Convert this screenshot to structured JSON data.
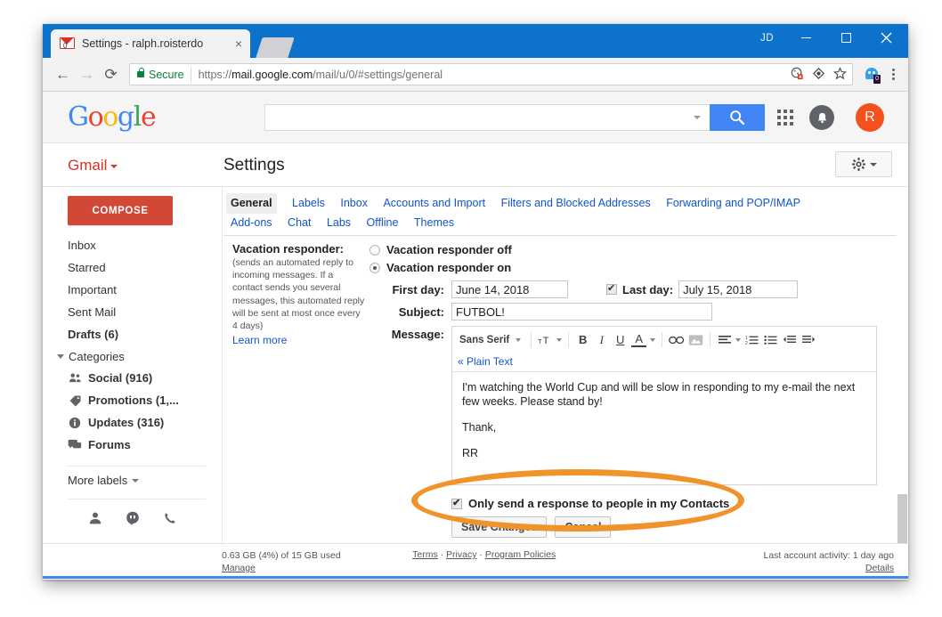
{
  "window": {
    "profile_label": "JD",
    "minimize_label": "Minimize",
    "maximize_label": "Maximize",
    "close_label": "Close"
  },
  "tab": {
    "title": "Settings - ralph.roisterdo",
    "badge_count": "0",
    "close_label": "×",
    "favicon": "gmail-icon"
  },
  "browser": {
    "back_icon": "←",
    "forward_icon": "→",
    "reload_icon": "⟳",
    "security_label": "Secure",
    "url_scheme": "https://",
    "url_host": "mail.google.com",
    "url_path": "/mail/u/0/#settings/general",
    "url_full": "https://mail.google.com/mail/u/0/#settings/general",
    "extension_badge": "0",
    "menu_icon": "kebab-menu-icon"
  },
  "gheader": {
    "logo": "Google",
    "logo_letters": [
      {
        "ch": "G",
        "cls": "b"
      },
      {
        "ch": "o",
        "cls": "r"
      },
      {
        "ch": "o",
        "cls": "y"
      },
      {
        "ch": "g",
        "cls": "b"
      },
      {
        "ch": "l",
        "cls": "g"
      },
      {
        "ch": "e",
        "cls": "r"
      }
    ],
    "search_value": "",
    "search_placeholder": "",
    "search_button_icon": "search-icon",
    "apps_icon": "apps-grid-icon",
    "notifications_icon": "bell-icon",
    "avatar_letter": "R"
  },
  "subheader": {
    "gmail_label": "Gmail",
    "page_title": "Settings",
    "gear_icon": "gear-icon"
  },
  "sidebar": {
    "compose_label": "COMPOSE",
    "items": [
      {
        "label": "Inbox",
        "bold": false
      },
      {
        "label": "Starred",
        "bold": false
      },
      {
        "label": "Important",
        "bold": false
      },
      {
        "label": "Sent Mail",
        "bold": false
      },
      {
        "label": "Drafts (6)",
        "bold": true
      }
    ],
    "categories_label": "Categories",
    "categories": [
      {
        "label": "Social (916)",
        "icon": "people-icon"
      },
      {
        "label": "Promotions (1,...",
        "icon": "tag-icon"
      },
      {
        "label": "Updates (316)",
        "icon": "info-icon"
      },
      {
        "label": "Forums",
        "icon": "forum-icon"
      }
    ],
    "more_labels": "More labels",
    "chat_icons": [
      "person-icon",
      "hangouts-icon",
      "phone-icon"
    ]
  },
  "settings_tabs": {
    "row1": [
      {
        "label": "General",
        "active": true
      },
      {
        "label": "Labels",
        "active": false
      },
      {
        "label": "Inbox",
        "active": false
      },
      {
        "label": "Accounts and Import",
        "active": false
      },
      {
        "label": "Filters and Blocked Addresses",
        "active": false
      },
      {
        "label": "Forwarding and POP/IMAP",
        "active": false
      }
    ],
    "row2": [
      {
        "label": "Add-ons",
        "active": false
      },
      {
        "label": "Chat",
        "active": false
      },
      {
        "label": "Labs",
        "active": false
      },
      {
        "label": "Offline",
        "active": false
      },
      {
        "label": "Themes",
        "active": false
      }
    ]
  },
  "vacation": {
    "title": "Vacation responder:",
    "note": "(sends an automated reply to incoming messages. If a contact sends you several messages, this automated reply will be sent at most once every 4 days)",
    "learn_more": "Learn more",
    "radio_off_label": "Vacation responder off",
    "radio_on_label": "Vacation responder on",
    "radio_selected": "on",
    "first_day_label": "First day:",
    "first_day_value": "June 14, 2018",
    "last_day_checked": true,
    "last_day_label": "Last day:",
    "last_day_value": "July 15, 2018",
    "subject_label": "Subject:",
    "subject_value": "FUTBOL!",
    "message_label": "Message:",
    "message_paragraphs": [
      "I'm watching the World Cup and will be slow in responding to my e-mail the next few weeks. Please stand by!",
      "Thank,",
      "RR"
    ],
    "only_contacts_label": "Only send a response to people in my Contacts",
    "only_contacts_checked": true,
    "save_label": "Save Changes",
    "cancel_label": "Cancel"
  },
  "editor_toolbar": {
    "font_label": "Sans Serif",
    "plain_text_label": "« Plain Text",
    "buttons": [
      {
        "icon": "font-size-icon",
        "label": "Size"
      },
      {
        "icon": "bold-icon",
        "label": "B"
      },
      {
        "icon": "italic-icon",
        "label": "I"
      },
      {
        "icon": "underline-icon",
        "label": "U"
      },
      {
        "icon": "text-color-icon",
        "label": "A"
      },
      {
        "icon": "link-icon",
        "label": "Link"
      },
      {
        "icon": "image-icon",
        "label": "Image"
      },
      {
        "icon": "align-icon",
        "label": "Align"
      },
      {
        "icon": "numbered-list-icon",
        "label": "Numbered list"
      },
      {
        "icon": "bulleted-list-icon",
        "label": "Bulleted list"
      },
      {
        "icon": "outdent-icon",
        "label": "Outdent"
      },
      {
        "icon": "indent-icon",
        "label": "Indent"
      }
    ]
  },
  "footer": {
    "storage": "0.63 GB (4%) of 15 GB used",
    "manage": "Manage",
    "terms": "Terms",
    "privacy": "Privacy",
    "policies": "Program Policies",
    "sep": " · ",
    "activity": "Last account activity: 1 day ago",
    "details": "Details"
  },
  "annotation": {
    "shape": "ellipse-highlight",
    "color": "#f0932b",
    "target": "only-send-response-to-contacts-checkbox"
  }
}
